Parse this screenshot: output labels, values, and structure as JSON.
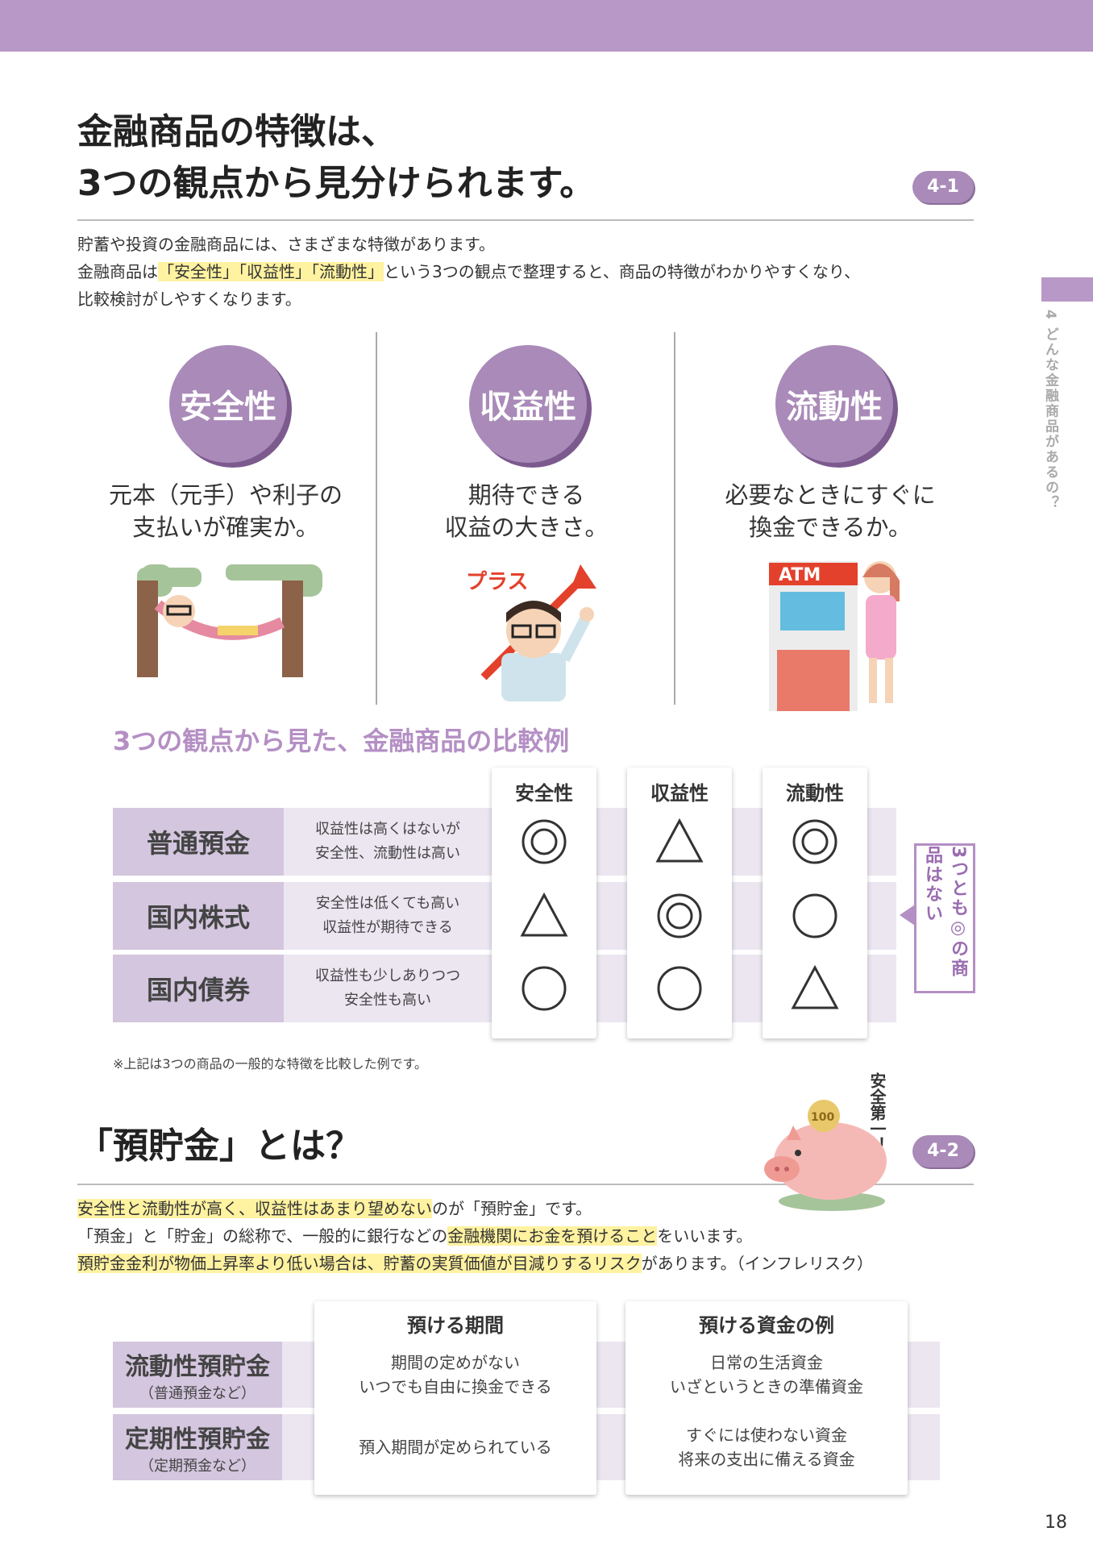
{
  "header": {
    "side_label": "4 どんな金融商品があるの？"
  },
  "section1": {
    "title_line1": "金融商品の特徴は、",
    "title_line2": "3つの観点から見分けられます。",
    "badge": "4-1",
    "body_line1": "貯蓄や投資の金融商品には、さまざまな特徴があります。",
    "body_line2_pre": "金融商品は",
    "body_line2_hl": "「安全性」「収益性」「流動性」",
    "body_line2_post": "という3つの観点で整理すると、商品の特徴がわかりやすくなり、",
    "body_line3": "比較検討がしやすくなります。",
    "perspectives": [
      {
        "label": "安全性",
        "desc1": "元本（元手）や利子の",
        "desc2": "支払いが確実か。"
      },
      {
        "label": "収益性",
        "desc1": "期待できる",
        "desc2": "収益の大きさ。"
      },
      {
        "label": "流動性",
        "desc1": "必要なときにすぐに",
        "desc2": "換金できるか。"
      }
    ],
    "illus": {
      "plus_text": "プラス",
      "atm_text": "ATM"
    }
  },
  "comparison": {
    "subtitle": "3つの観点から見た、金融商品の比較例",
    "columns": [
      "安全性",
      "収益性",
      "流動性"
    ],
    "rows": [
      {
        "name": "普通預金",
        "desc1": "収益性は高くはないが",
        "desc2": "安全性、流動性は高い",
        "marks": [
          "double-circle",
          "triangle",
          "double-circle"
        ]
      },
      {
        "name": "国内株式",
        "desc1": "安全性は低くても高い",
        "desc2": "収益性が期待できる",
        "marks": [
          "triangle",
          "double-circle",
          "circle"
        ]
      },
      {
        "name": "国内債券",
        "desc1": "収益性も少しありつつ",
        "desc2": "安全性も高い",
        "marks": [
          "circle",
          "circle",
          "triangle"
        ]
      }
    ],
    "callout": "3つとも◎の商品はない",
    "note": "※上記は3つの商品の一般的な特徴を比較した例です。"
  },
  "section2": {
    "title": "「預貯金」とは？",
    "badge": "4-2",
    "piggy_text": "安全第一！",
    "coin_text": "100",
    "line1_hl": "安全性と流動性が高く、収益性はあまり望めない",
    "line1_post": "のが「預貯金」です。",
    "line2_pre": "「預金」と「貯金」の総称で、一般的に銀行などの",
    "line2_hl": "金融機関にお金を預けること",
    "line2_post": "をいいます。",
    "line3_hl": "預貯金金利が物価上昇率より低い場合は、貯蓄の実質価値が目減りするリスク",
    "line3_post": "があります。（インフレリスク）",
    "columns": [
      "預ける期間",
      "預ける資金の例"
    ],
    "rows": [
      {
        "name": "流動性預貯金",
        "sub": "（普通預金など）",
        "period1": "期間の定めがない",
        "period2": "いつでも自由に換金できる",
        "funds1": "日常の生活資金",
        "funds2": "いざというときの準備資金"
      },
      {
        "name": "定期性預貯金",
        "sub": "（定期預金など）",
        "period1": "預入期間が定められている",
        "period2": "",
        "funds1": "すぐには使わない資金",
        "funds2": "将来の支出に備える資金"
      }
    ]
  },
  "footer": {
    "page_number": "18"
  }
}
